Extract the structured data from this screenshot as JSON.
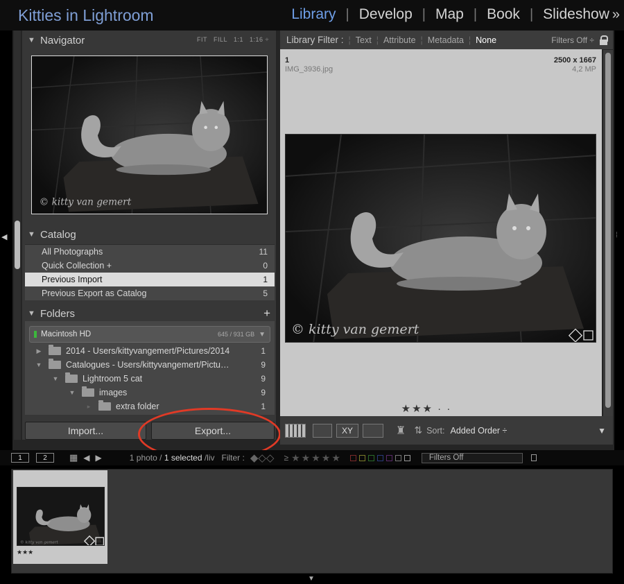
{
  "app": {
    "title": "Kitties in Lightroom"
  },
  "modules": {
    "items": [
      "Library",
      "Develop",
      "Map",
      "Book",
      "Slideshow"
    ],
    "active": "Library",
    "more": "»"
  },
  "navigator": {
    "title": "Navigator",
    "zoom": [
      "FIT",
      "FILL",
      "1:1",
      "1:16 ÷"
    ]
  },
  "photo": {
    "watermark": "© kitty van gemert"
  },
  "catalog": {
    "title": "Catalog",
    "items": [
      {
        "label": "All Photographs",
        "count": "11"
      },
      {
        "label": "Quick Collection +",
        "count": "0"
      },
      {
        "label": "Previous Import",
        "count": "1"
      },
      {
        "label": "Previous Export as Catalog",
        "count": "5"
      }
    ]
  },
  "folders": {
    "title": "Folders",
    "add": "+",
    "volume": {
      "name": "Macintosh HD",
      "size": "645 / 931 GB"
    },
    "items": [
      {
        "label": "2014 - Users/kittyvangemert/Pictures/2014",
        "count": "1"
      },
      {
        "label": "Catalogues - Users/kittyvangemert/Pictu…",
        "count": "9"
      },
      {
        "label": "Lightroom 5 cat",
        "count": "9"
      },
      {
        "label": "images",
        "count": "9"
      },
      {
        "label": "extra folder",
        "count": "1"
      }
    ]
  },
  "buttons": {
    "import": "Import...",
    "export": "Export..."
  },
  "filter": {
    "title": "Library Filter :",
    "options": [
      "Text",
      "Attribute",
      "Metadata",
      "None"
    ],
    "active": "None",
    "filters_off": "Filters Off ÷"
  },
  "image": {
    "index": "1",
    "filename": "IMG_3936.jpg",
    "dimensions": "2500 x 1667",
    "megapixels": "4,2 MP",
    "rating": "★★★ · ·"
  },
  "toolbar": {
    "sort_label": "Sort:",
    "sort_value": "Added Order ÷",
    "menu": "▼"
  },
  "filmstrip": {
    "screens": [
      "1",
      "2"
    ],
    "info_count": "1 photo / ",
    "info_selected": "1 selected",
    "info_rest": " /liv",
    "filter_label": "Filter :",
    "gte": "≥",
    "filters_off": "Filters Off",
    "thumb_stars": "★★★",
    "thumb_watermark": "© kitty van gemert"
  }
}
